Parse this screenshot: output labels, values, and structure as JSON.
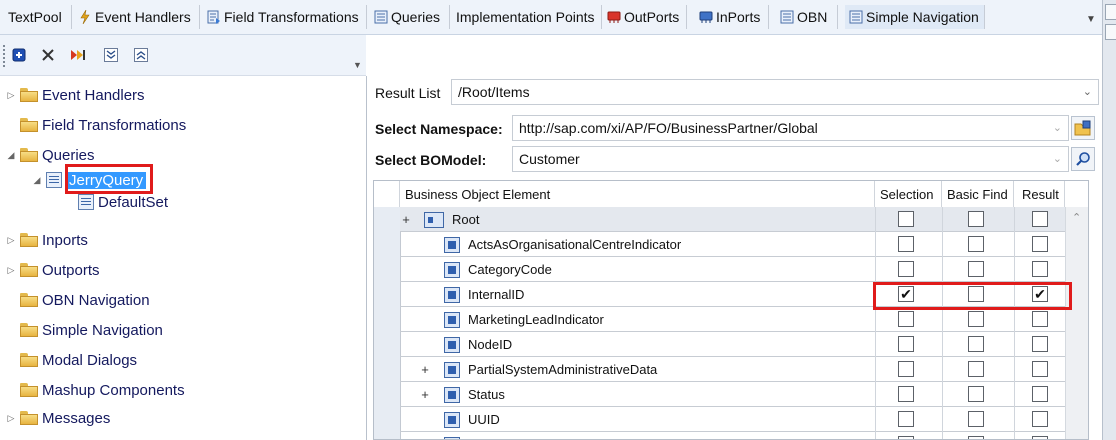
{
  "tabs": [
    {
      "label": "TextPool",
      "icon": "none"
    },
    {
      "label": "Event Handlers",
      "icon": "lightning-icon"
    },
    {
      "label": "Field Transformations",
      "icon": "transform-icon"
    },
    {
      "label": "Queries",
      "icon": "query-icon"
    },
    {
      "label": "Implementation Points",
      "icon": "none"
    },
    {
      "label": "OutPorts",
      "icon": "outport-icon"
    },
    {
      "label": "InPorts",
      "icon": "inport-icon"
    },
    {
      "label": "OBN",
      "icon": "obn-icon"
    },
    {
      "label": "Simple Navigation",
      "icon": "navigation-icon"
    }
  ],
  "toolbar": {
    "buttons": [
      "add-icon",
      "delete-icon",
      "forward-icon",
      "expand-all-icon",
      "collapse-all-icon"
    ]
  },
  "tree": {
    "items": [
      {
        "label": "Event Handlers",
        "expandable": true
      },
      {
        "label": "Field Transformations",
        "expandable": false
      },
      {
        "label": "Queries",
        "expandable": true,
        "expanded": true
      },
      {
        "label": "JerryQuery",
        "selected": true
      },
      {
        "label": "DefaultSet"
      },
      {
        "label": "Inports",
        "expandable": true
      },
      {
        "label": "Outports",
        "expandable": true
      },
      {
        "label": "OBN Navigation",
        "expandable": false
      },
      {
        "label": "Simple Navigation",
        "expandable": false
      },
      {
        "label": "Modal Dialogs",
        "expandable": false
      },
      {
        "label": "Mashup Components",
        "expandable": false
      },
      {
        "label": "Messages",
        "expandable": true
      }
    ]
  },
  "form": {
    "result_list_label": "Result List",
    "result_list_value": "/Root/Items",
    "namespace_label": "Select Namespace:",
    "namespace_value": "http://sap.com/xi/AP/FO/BusinessPartner/Global",
    "bomodel_label": "Select BOModel:",
    "bomodel_value": "Customer"
  },
  "grid": {
    "columns": {
      "element": "Business Object Element",
      "selection": "Selection",
      "basic_find": "Basic Find",
      "result": "Result"
    },
    "rows": [
      {
        "name": "Root",
        "expand": "+",
        "level": 0,
        "selection": false,
        "basic_find": false,
        "result": false
      },
      {
        "name": "ActsAsOrganisationalCentreIndicator",
        "expand": "",
        "level": 1,
        "selection": false,
        "basic_find": false,
        "result": false
      },
      {
        "name": "CategoryCode",
        "expand": "",
        "level": 1,
        "selection": false,
        "basic_find": false,
        "result": false
      },
      {
        "name": "InternalID",
        "expand": "",
        "level": 1,
        "selection": true,
        "basic_find": false,
        "result": true
      },
      {
        "name": "MarketingLeadIndicator",
        "expand": "",
        "level": 1,
        "selection": false,
        "basic_find": false,
        "result": false
      },
      {
        "name": "NodeID",
        "expand": "",
        "level": 1,
        "selection": false,
        "basic_find": false,
        "result": false
      },
      {
        "name": "PartialSystemAdministrativeData",
        "expand": "+",
        "level": 1,
        "selection": false,
        "basic_find": false,
        "result": false
      },
      {
        "name": "Status",
        "expand": "+",
        "level": 1,
        "selection": false,
        "basic_find": false,
        "result": false
      },
      {
        "name": "UUID",
        "expand": "",
        "level": 1,
        "selection": false,
        "basic_find": false,
        "result": false
      },
      {
        "name": "",
        "expand": "",
        "level": 1,
        "selection": false,
        "basic_find": false,
        "result": false
      }
    ]
  },
  "colors": {
    "highlight_box": "#e01b1b",
    "selection": "#3399ff",
    "tab_bar": "#eef3fa"
  }
}
